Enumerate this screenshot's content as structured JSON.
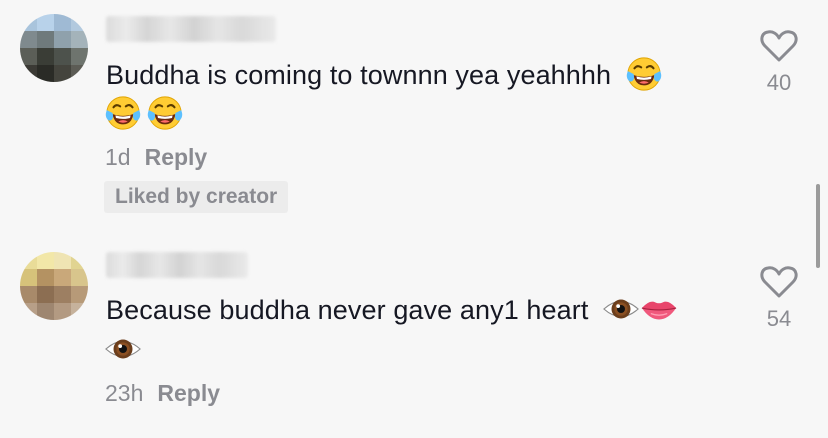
{
  "comments": [
    {
      "text": "Buddha is coming to townnn yea yeahhhh",
      "time": "1d",
      "reply_label": "Reply",
      "badge": "Liked by creator",
      "likes": "40",
      "inline_emoji": [
        "face-with-tears-of-joy-icon"
      ],
      "extra_emoji": [
        "face-with-tears-of-joy-icon",
        "face-with-tears-of-joy-icon"
      ]
    },
    {
      "text": "Because buddha never gave any1 heart",
      "time": "23h",
      "reply_label": "Reply",
      "likes": "54",
      "inline_emoji": [
        "eye-icon",
        "lips-icon"
      ],
      "extra_emoji": [
        "eye-icon"
      ]
    }
  ],
  "colors": {
    "background": "#f7f7f7",
    "text": "#161823",
    "muted": "#8a8b91",
    "badge_bg": "#ececec"
  }
}
